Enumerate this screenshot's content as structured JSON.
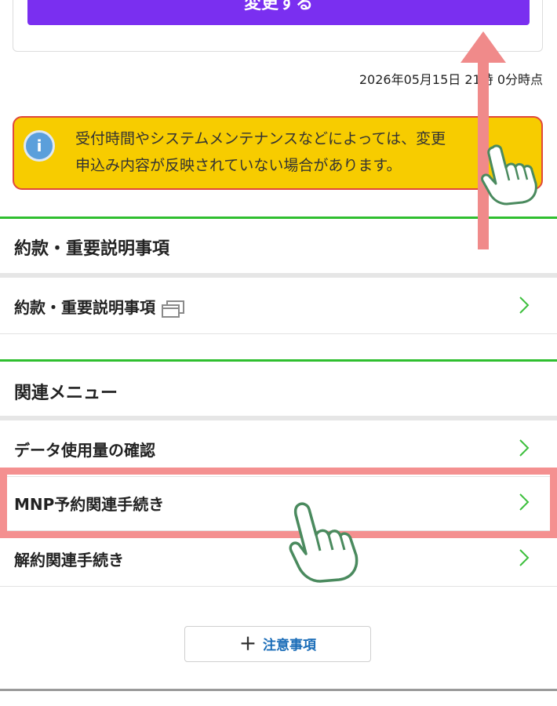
{
  "top_card": {
    "change_button_label": "変更する"
  },
  "timestamp": "2026年05月15日 21時 0分時点",
  "notice": {
    "line1": "受付時間やシステムメンテナンスなどによっては、変更",
    "line2": "申込み内容が反映されていない場合があります。"
  },
  "terms_section": {
    "heading": "約款・重要説明事項",
    "item_label": "約款・重要説明事項"
  },
  "related_section": {
    "heading": "関連メニュー",
    "items": [
      {
        "label": "データ使用量の確認"
      },
      {
        "label": "MNP予約関連手続き"
      },
      {
        "label": "解約関連手続き"
      }
    ]
  },
  "caution_button": {
    "label": "注意事項"
  },
  "colors": {
    "primary_purple": "#7a2ff0",
    "notice_yellow": "#f7cc00",
    "notice_border": "#e0483c",
    "section_green": "#2fbf2f",
    "chevron_green": "#3cbf3c",
    "highlight_pink": "#f49090",
    "link_blue": "#1b6db8"
  },
  "icons": {
    "info": "info-icon",
    "external_window": "external-window-icon",
    "chevron": "chevron-right-icon",
    "plus": "plus-icon",
    "pointing_hand": "pointing-hand-icon",
    "arrow_up": "arrow-up-icon"
  }
}
